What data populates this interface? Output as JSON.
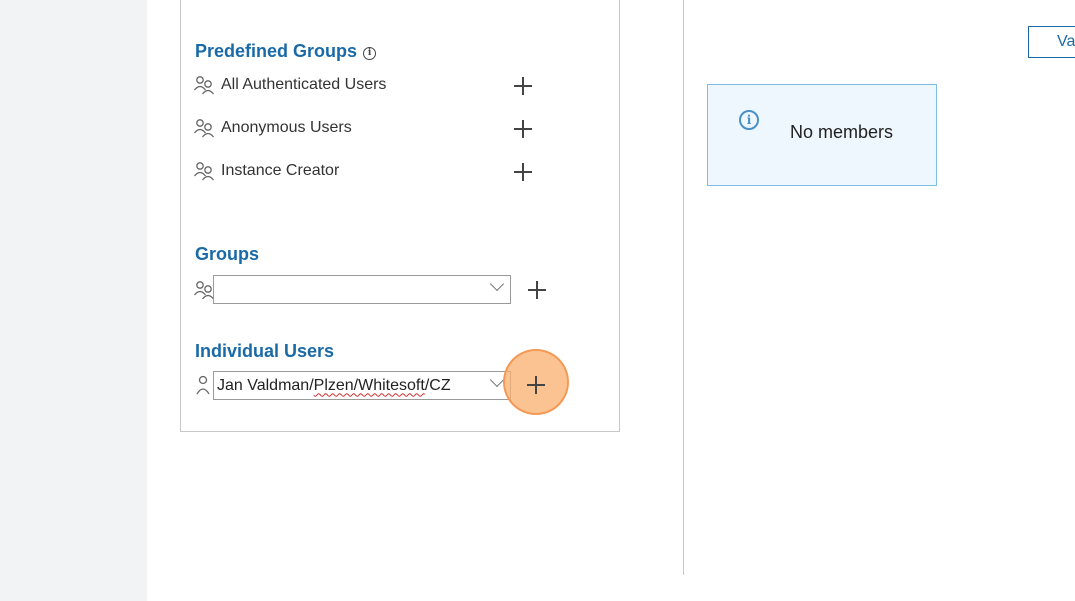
{
  "predefined_groups": {
    "title": "Predefined Groups",
    "info_icon": "info-circle-icon",
    "items": [
      {
        "label": "All Authenticated Users",
        "icon": "group-icon"
      },
      {
        "label": "Anonymous Users",
        "icon": "group-icon"
      },
      {
        "label": "Instance Creator",
        "icon": "group-icon"
      }
    ]
  },
  "groups": {
    "title": "Groups",
    "select_value": "",
    "icon": "group-icon"
  },
  "individual_users": {
    "title": "Individual Users",
    "select_value_prefix": "Jan Valdman/",
    "select_value_misspelled": "Plzen/Whitesoft",
    "select_value_suffix": "/CZ",
    "icon": "user-icon"
  },
  "members": {
    "top_button_label": "Va",
    "notice_text": "No members",
    "notice_icon": "info-circle-icon"
  },
  "colors": {
    "accent": "#1a6aa8",
    "notice_bg": "#eef7fd",
    "notice_border": "#7fbde6",
    "highlight": "#f7a86a"
  }
}
